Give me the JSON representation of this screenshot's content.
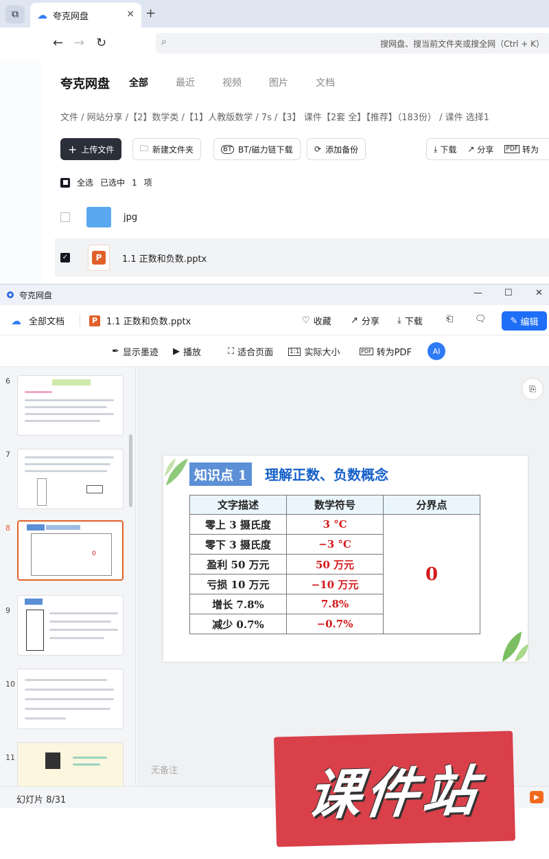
{
  "browser": {
    "tab_title": "夸克网盘",
    "search_placeholder": "搜网盘、搜当前文件夹或搜全网（Ctrl + K）"
  },
  "drive": {
    "brand": "夸克网盘",
    "tabs": [
      "全部",
      "最近",
      "视频",
      "图片",
      "文档"
    ],
    "active_tab": "全部",
    "breadcrumb": "文件 / 网站分享 /【2】数学类 /【1】人教版数学 / 7s /【3】 课件【2套 全】【推荐】（183份） / 课件 选择1",
    "toolbar": {
      "upload": "上传文件",
      "new_folder": "新建文件夹",
      "bt": "BT/磁力链下载",
      "backup": "添加备份",
      "download": "下载",
      "share": "分享",
      "to_pdf": "转为"
    },
    "selection": {
      "select_all": "全选",
      "selected": "已选中",
      "count": "1",
      "unit": "项"
    },
    "files": [
      {
        "name": "jpg",
        "type": "folder",
        "checked": false
      },
      {
        "name": "1.1 正数和负数.pptx",
        "type": "pptx",
        "checked": true
      }
    ]
  },
  "viewer": {
    "window_title": "夸克网盘",
    "all_docs": "全部文档",
    "file_name": "1.1 正数和负数.pptx",
    "collect": "收藏",
    "share": "分享",
    "download": "下载",
    "edit": "编辑",
    "tools": {
      "ink": "显示墨迹",
      "play": "播放",
      "fit": "适合页面",
      "actual": "实际大小",
      "pdf": "转为PDF"
    },
    "thumb_numbers": [
      "6",
      "7",
      "8",
      "9",
      "10",
      "11"
    ],
    "no_notes": "无备注",
    "slide_count": "幻灯片 8/31"
  },
  "slide": {
    "badge": "知识点 1",
    "title": "理解正数、负数概念",
    "headers": [
      "文字描述",
      "数学符号",
      "分界点"
    ],
    "rows": [
      [
        "零上 3 摄氏度",
        "3 °C"
      ],
      [
        "零下 3 摄氏度",
        "−3 °C"
      ],
      [
        "盈利 50 万元",
        "50 万元"
      ],
      [
        "亏损 10 万元",
        "−10 万元"
      ],
      [
        "增长 7.8%",
        "7.8%"
      ],
      [
        "减少 0.7%",
        "−0.7%"
      ]
    ],
    "boundary": "0"
  },
  "watermark": "课件站",
  "colors": {
    "accent": "#1f6ef7",
    "slide_red": "#d4191b",
    "current_thumb": "#e0612a",
    "watermark": "#d9404a"
  }
}
